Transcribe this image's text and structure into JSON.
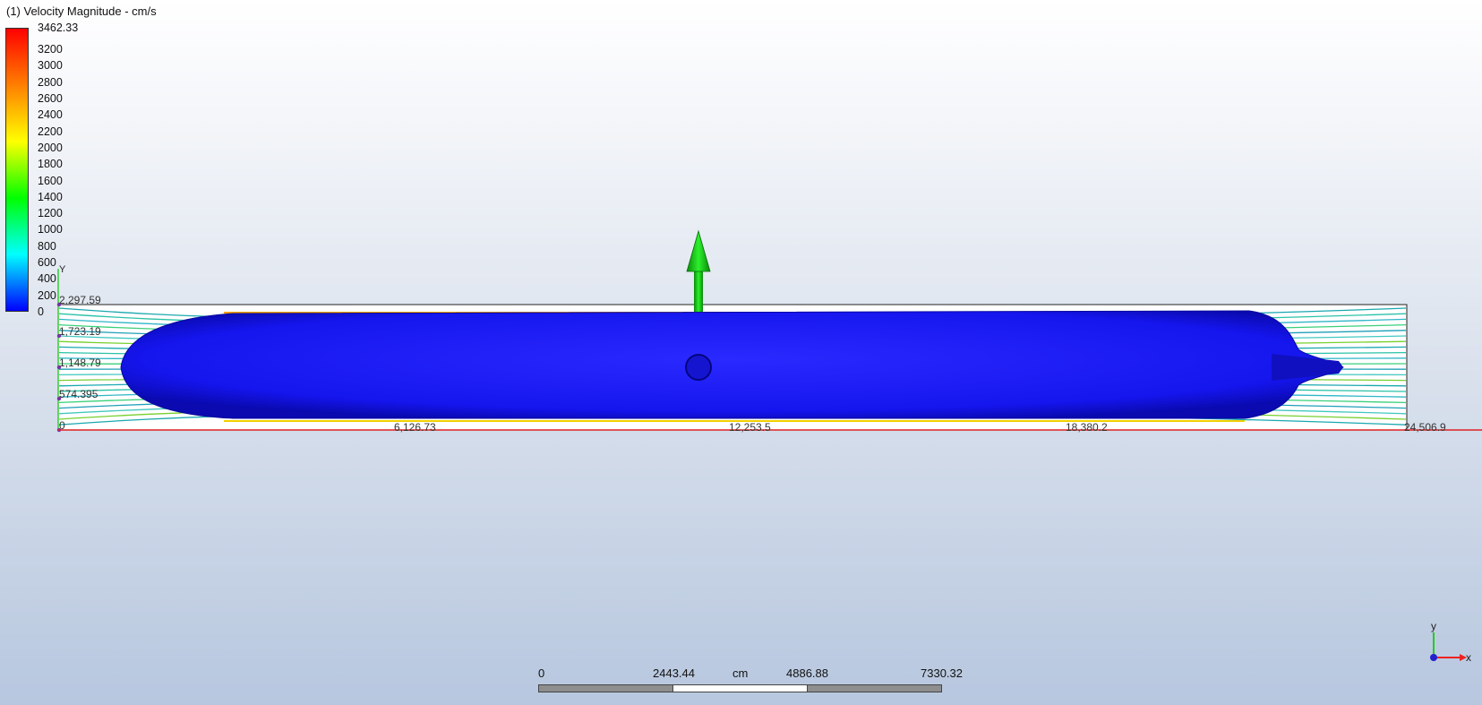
{
  "title": "(1) Velocity Magnitude - cm/s",
  "legend": {
    "max_label": "3462.33",
    "ticks": [
      "3200",
      "3000",
      "2800",
      "2600",
      "2400",
      "2200",
      "2000",
      "1800",
      "1600",
      "1400",
      "1200",
      "1000",
      "800",
      "600",
      "400",
      "200",
      "0"
    ],
    "tick_values": [
      3200,
      3000,
      2800,
      2600,
      2400,
      2200,
      2000,
      1800,
      1600,
      1400,
      1200,
      1000,
      800,
      600,
      400,
      200,
      0
    ],
    "max_value": 3462.33,
    "colors": [
      "#ff0000",
      "#ff7f00",
      "#ffff00",
      "#00ff00",
      "#00ffff",
      "#0000ff"
    ]
  },
  "view": {
    "axis_y_label": "Y",
    "vertical_ticks": [
      "2,297.59",
      "1,723.19",
      "1,148.79",
      "574.395",
      "0"
    ],
    "horizontal_ticks": [
      "6,126.73",
      "12,253.5",
      "18,380.2",
      "24,506.9"
    ],
    "body_color": "#1a1aff",
    "arrow_color": "#22dd22"
  },
  "triad": {
    "y_label": "y",
    "x_label": "x"
  },
  "scale_bar": {
    "labels": [
      "0",
      "2443.44",
      "cm",
      "4886.88",
      "7330.32"
    ]
  }
}
